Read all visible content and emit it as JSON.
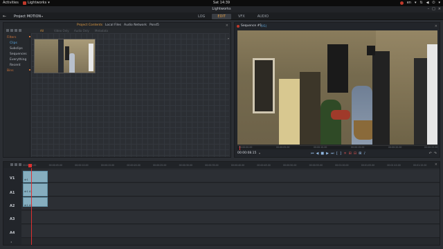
{
  "topbar": {
    "activities": "Activities",
    "app_name": "Lightworks",
    "clock": "Sat 14:39",
    "keyboard": "en"
  },
  "window": {
    "title": "Lightworks"
  },
  "appbar": {
    "project_name": "Project MOTION",
    "tabs": [
      {
        "label": "LOG",
        "active": false
      },
      {
        "label": "EDIT",
        "active": true
      },
      {
        "label": "VFX",
        "active": false
      },
      {
        "label": "AUDIO",
        "active": false
      }
    ]
  },
  "project_panel": {
    "tabs": [
      {
        "label": "Project Contents",
        "active": true
      },
      {
        "label": "Local Files",
        "active": false
      },
      {
        "label": "Audio Network",
        "active": false
      },
      {
        "label": "Pond5",
        "active": false
      }
    ],
    "subtabs": [
      {
        "label": "All",
        "active": true
      },
      {
        "label": "Video Only",
        "active": false
      },
      {
        "label": "Audio Only",
        "active": false
      },
      {
        "label": "Metadata",
        "active": false
      }
    ],
    "sidebar": {
      "filters_header": "Filters",
      "items": [
        {
          "label": "Clips",
          "selected": true
        },
        {
          "label": "Subclips",
          "selected": false
        },
        {
          "label": "Sequences",
          "selected": false
        },
        {
          "label": "Everything",
          "selected": false
        },
        {
          "label": "Recent",
          "selected": false
        }
      ],
      "bins_header": "Bins"
    }
  },
  "viewer": {
    "title": "Sequence #1",
    "source": "(V1)",
    "timecode": "00:00:08.15",
    "timecode_dropdown": "▾",
    "ruler_ticks": [
      "00:00:00.00",
      "00:00:05.00",
      "00:00:10.00",
      "00:00:15.00",
      "00:00:20.00",
      "00:00:25.00"
    ]
  },
  "timeline": {
    "ruler_ticks": [
      "00:00:00.00",
      "00:00:05.00",
      "00:00:10.00",
      "00:00:15.00",
      "00:00:20.00",
      "00:00:25.00",
      "00:00:30.00",
      "00:00:35.00",
      "00:00:40.00",
      "00:00:45.00",
      "00:00:50.00",
      "00:00:55.00",
      "00:01:00.00",
      "00:01:05.00",
      "00:01:10.00",
      "00:01:15.00"
    ],
    "tracks": [
      "V1",
      "A1",
      "A2",
      "A3",
      "A4"
    ],
    "clip_labels": {
      "v1": "dr1",
      "a1": "dr1 A1",
      "a2": "dr1 A2"
    }
  },
  "colors": {
    "accent_orange": "#e09a40",
    "accent_blue": "#5aa7e0",
    "playhead_red": "#e03030",
    "clip_blue": "#86aebf"
  }
}
